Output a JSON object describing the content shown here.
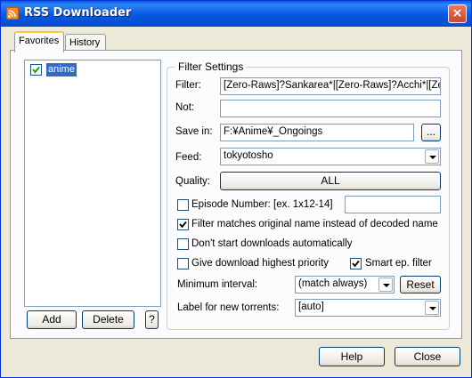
{
  "window": {
    "title": "RSS Downloader",
    "close_glyph": "×"
  },
  "tabs": [
    {
      "label": "Favorites",
      "active": true
    },
    {
      "label": "History",
      "active": false
    }
  ],
  "favorites": {
    "items": [
      {
        "label": "anime",
        "checked": true
      }
    ]
  },
  "list_buttons": {
    "add": "Add",
    "delete": "Delete",
    "help": "?"
  },
  "filter": {
    "group_title": "Filter Settings",
    "filter_label": "Filter:",
    "filter_value": "[Zero-Raws]?Sankarea*|[Zero-Raws]?Acchi*|[Zero",
    "not_label": "Not:",
    "not_value": "",
    "save_in_label": "Save in:",
    "save_in_value": "F:¥Anime¥_Ongoings",
    "browse_label": "...",
    "feed_label": "Feed:",
    "feed_value": "tokyotosho",
    "quality_label": "Quality:",
    "quality_value": "ALL",
    "episode_label": "Episode Number: [ex. 1x12-14]",
    "episode_value": "",
    "episode_checked": false,
    "original_name_label": "Filter matches original name instead of decoded name",
    "original_name_checked": true,
    "no_autostart_label": "Don't start downloads automatically",
    "no_autostart_checked": false,
    "high_priority_label": "Give download highest priority",
    "high_priority_checked": false,
    "smart_ep_label": "Smart ep. filter",
    "smart_ep_checked": true,
    "min_interval_label": "Minimum interval:",
    "min_interval_value": "(match always)",
    "reset_label": "Reset",
    "torrent_label_label": "Label for new torrents:",
    "torrent_label_value": "[auto]"
  },
  "footer": {
    "help": "Help",
    "close": "Close"
  },
  "colors": {
    "titlebar": "#0757e0",
    "selection": "#316ac5",
    "face": "#ece9d8"
  }
}
